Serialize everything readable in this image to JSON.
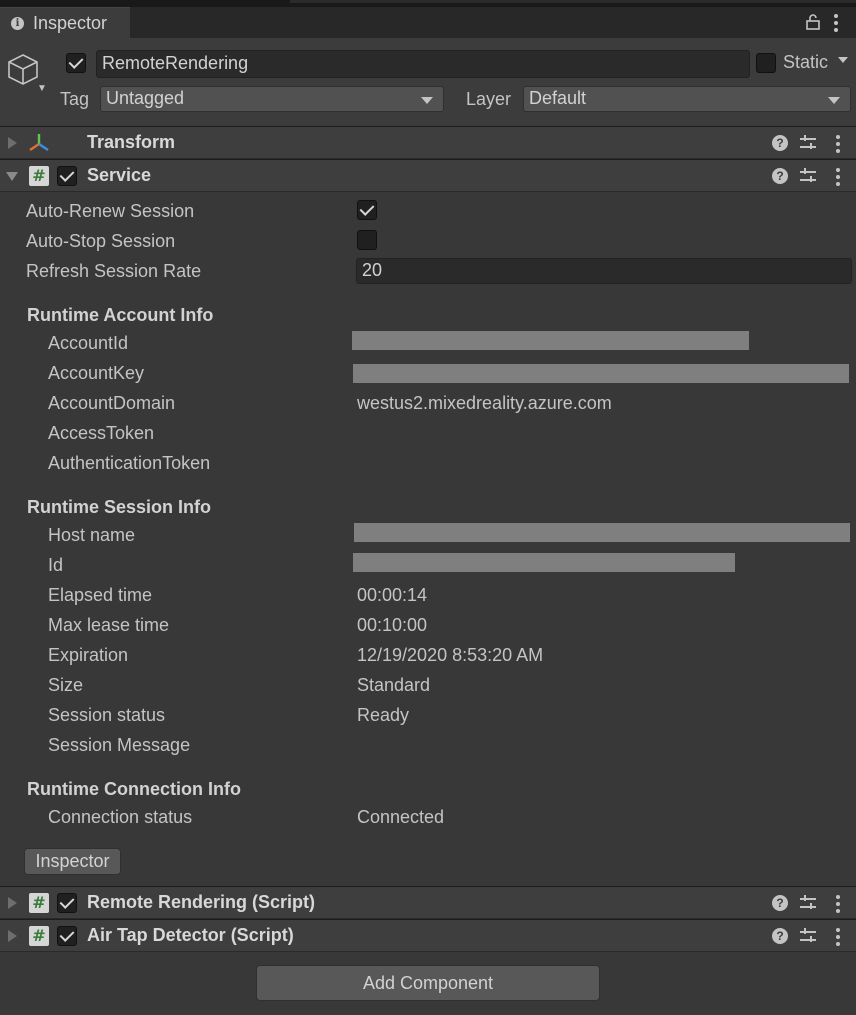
{
  "tab": {
    "title": "Inspector"
  },
  "gameobject": {
    "name": "RemoteRendering",
    "active": true,
    "static_label": "Static",
    "static_checked": false,
    "tag_label": "Tag",
    "tag_value": "Untagged",
    "layer_label": "Layer",
    "layer_value": "Default"
  },
  "components": {
    "transform": {
      "title": "Transform"
    },
    "service": {
      "title": "Service",
      "enabled": true,
      "fields": {
        "auto_renew_label": "Auto-Renew Session",
        "auto_renew_checked": true,
        "auto_stop_label": "Auto-Stop Session",
        "auto_stop_checked": false,
        "refresh_rate_label": "Refresh Session Rate",
        "refresh_rate_value": "20"
      },
      "account_info": {
        "heading": "Runtime Account Info",
        "account_id_label": "AccountId",
        "account_key_label": "AccountKey",
        "account_domain_label": "AccountDomain",
        "account_domain_value": "westus2.mixedreality.azure.com",
        "access_token_label": "AccessToken",
        "auth_token_label": "AuthenticationToken"
      },
      "session_info": {
        "heading": "Runtime Session Info",
        "host_name_label": "Host name",
        "id_label": "Id",
        "elapsed_label": "Elapsed time",
        "elapsed_value": "00:00:14",
        "max_lease_label": "Max lease time",
        "max_lease_value": "00:10:00",
        "expiration_label": "Expiration",
        "expiration_value": "12/19/2020 8:53:20 AM",
        "size_label": "Size",
        "size_value": "Standard",
        "status_label": "Session status",
        "status_value": "Ready",
        "message_label": "Session Message"
      },
      "connection_info": {
        "heading": "Runtime Connection Info",
        "status_label": "Connection status",
        "status_value": "Connected"
      },
      "inspector_button": "Inspector"
    },
    "remote_rendering": {
      "title": "Remote Rendering (Script)",
      "enabled": true
    },
    "air_tap": {
      "title": "Air Tap Detector (Script)",
      "enabled": true
    }
  },
  "add_component_label": "Add Component",
  "colors": {
    "panel_bg": "#383838",
    "header_bg": "#3e3e3e",
    "text": "#c4c4c4",
    "redaction": "#7f7f7f"
  }
}
